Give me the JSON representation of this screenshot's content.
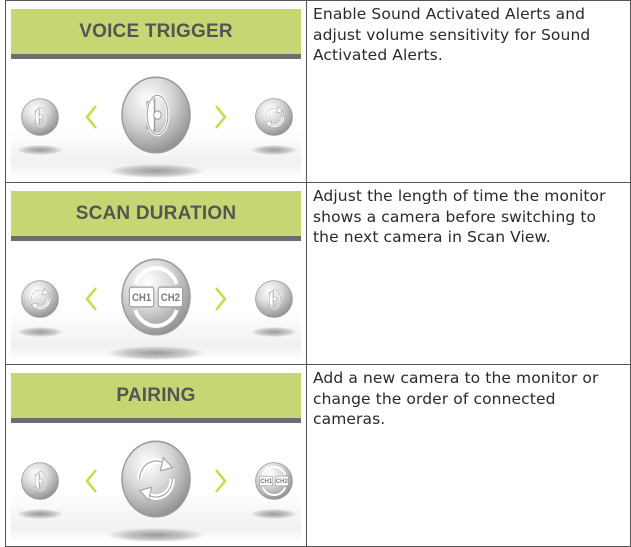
{
  "rows": [
    {
      "screen_title": "VOICE TRIGGER",
      "left_icon": "speaker-icon",
      "center_icon": "speaker-icon",
      "right_icon": "refresh-icon",
      "description": "Enable Sound Activated Alerts and adjust volume sensitivity for Sound Activated Alerts."
    },
    {
      "screen_title": "SCAN DURATION",
      "left_icon": "refresh-icon",
      "center_icon": "channel-switch-icon",
      "right_icon": "speaker-icon",
      "channel_labels": [
        "CH1",
        "CH2"
      ],
      "description": "Adjust the length of time the monitor shows a camera before switching to the next camera in Scan View."
    },
    {
      "screen_title": "PAIRING",
      "left_icon": "speaker-icon",
      "center_icon": "refresh-icon",
      "right_icon": "channel-switch-icon",
      "channel_labels": [
        "CH1",
        "CH2"
      ],
      "description": "Add a new camera to the monitor or change the order of connected cameras."
    }
  ],
  "colors": {
    "title_bar": "#c5d773",
    "title_underline": "#6d6d6d",
    "chevron": "#c8d94a",
    "icon_metal": "#9a9a9a"
  }
}
